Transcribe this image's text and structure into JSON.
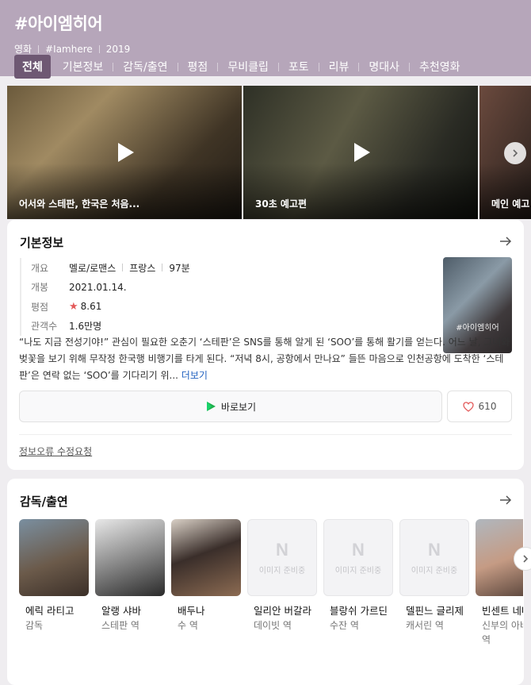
{
  "header": {
    "title": "#아이엠히어",
    "meta": [
      "영화",
      "#Iamhere",
      "2019"
    ],
    "tabs": [
      "전체",
      "기본정보",
      "감독/출연",
      "평점",
      "무비클립",
      "포토",
      "리뷰",
      "명대사",
      "추천영화"
    ]
  },
  "clips": [
    {
      "caption": "어서와 스테판, 한국은 처음..."
    },
    {
      "caption": "30초 예고편"
    },
    {
      "caption": "메인 예고"
    }
  ],
  "info": {
    "section_title": "기본정보",
    "rows": {
      "overview_key": "개요",
      "genre": "멜로/로맨스",
      "country": "프랑스",
      "runtime": "97분",
      "release_key": "개봉",
      "release": "2021.01.14.",
      "rating_key": "평점",
      "rating": "8.61",
      "audience_key": "관객수",
      "audience": "1.6만명"
    },
    "poster_title": "#아이엠히어",
    "synopsis": "“나도 지금 전성기야!” 관심이 필요한 오춘기 ‘스테판’은 SNS를 통해 알게 된 ‘SOO’를 통해 활기를 얻는다. 어느 날, 그녀와 벚꽃을 보기 위해 무작정 한국행 비행기를 타게 된다. “저녁 8시, 공항에서 만나요” 들뜬 마음으로 인천공항에 도착한 ‘스테판’은 연락 없는 ‘SOO’를 기다리기 위...",
    "more": "더보기",
    "watch_label": "바로보기",
    "like_count": "610",
    "report": "정보오류 수정요청"
  },
  "cast": {
    "section_title": "감독/출연",
    "placeholder_text": "이미지 준비중",
    "people": [
      {
        "name": "에릭 라티고",
        "role": "감독",
        "photo": true
      },
      {
        "name": "알랭 샤바",
        "role": "스테판 역",
        "photo": true
      },
      {
        "name": "배두나",
        "role": "수 역",
        "photo": true
      },
      {
        "name": "일리안 버갈라",
        "role": "데이빗 역",
        "photo": false
      },
      {
        "name": "블랑쉬 가르딘",
        "role": "수잔 역",
        "photo": false
      },
      {
        "name": "델핀느 글리제",
        "role": "캐서린 역",
        "photo": false
      },
      {
        "name": "빈센트 네메스",
        "role": "신부의 아버지 역",
        "photo": true
      }
    ]
  },
  "colors": {
    "header_bg": "#b6a6ba",
    "active_tab": "#6e5873",
    "star": "#e35a5a",
    "link": "#1f5fbf"
  }
}
